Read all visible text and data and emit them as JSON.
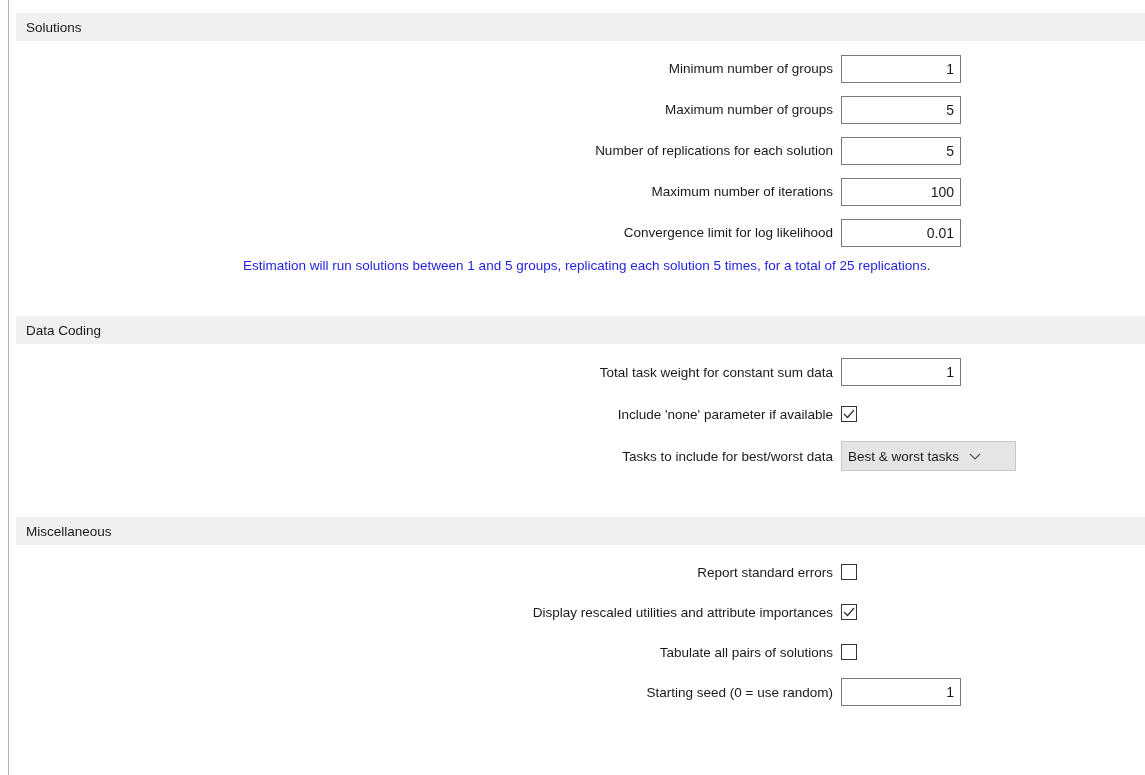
{
  "sections": [
    {
      "title": "Solutions",
      "rows": [
        {
          "kind": "number",
          "label": "Minimum number of groups",
          "value": "1"
        },
        {
          "kind": "number",
          "label": "Maximum number of groups",
          "value": "5"
        },
        {
          "kind": "number",
          "label": "Number of replications for each solution",
          "value": "5"
        },
        {
          "kind": "number",
          "label": "Maximum number of iterations",
          "value": "100"
        },
        {
          "kind": "number",
          "label": "Convergence limit for log likelihood",
          "value": "0.01"
        }
      ],
      "note": "Estimation will run solutions between 1 and 5 groups, replicating each solution 5 times, for a total of 25 replications."
    },
    {
      "title": "Data Coding",
      "rows": [
        {
          "kind": "number",
          "label": "Total task weight for constant sum data",
          "value": "1"
        },
        {
          "kind": "checkbox",
          "label": "Include 'none' parameter if available",
          "checked": true
        },
        {
          "kind": "dropdown",
          "label": "Tasks to include for best/worst data",
          "value": "Best & worst tasks"
        }
      ]
    },
    {
      "title": "Miscellaneous",
      "rows": [
        {
          "kind": "checkbox",
          "label": "Report standard errors",
          "checked": false
        },
        {
          "kind": "checkbox",
          "label": "Display rescaled utilities and attribute importances",
          "checked": true
        },
        {
          "kind": "checkbox",
          "label": "Tabulate all pairs of solutions",
          "checked": false
        },
        {
          "kind": "number",
          "label": "Starting seed (0 = use random)",
          "value": "1"
        }
      ]
    }
  ]
}
